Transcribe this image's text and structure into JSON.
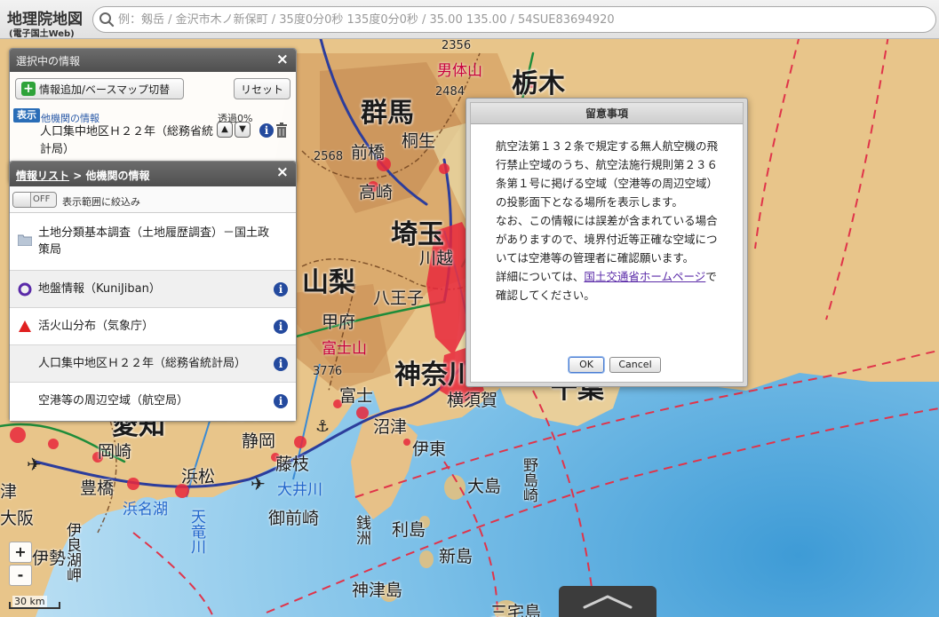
{
  "header": {
    "logo_title": "地理院地図",
    "logo_subtitle": "(電子国土Web)",
    "search_placeholder": "例：剱岳 / 金沢市木ノ新保町 / 35度0分0秒 135度0分0秒 / 35.00 135.00 / 54SUE83694920"
  },
  "selected_panel": {
    "title": "選択中の情報",
    "add_button_label": "情報追加/ベースマップ切替",
    "reset_button_label": "リセット",
    "show_badge": "表示",
    "item_category": "他機関の情報",
    "item_name": "人口集中地区Ｈ２２年（総務省統計局）",
    "opacity_label": "透過0%"
  },
  "list_panel": {
    "breadcrumb_link": "情報リスト",
    "breadcrumb_sep": " > ",
    "breadcrumb_current": "他機関の情報",
    "toggle_label": "OFF",
    "filter_label": "表示範囲に絞込み",
    "items": [
      {
        "label": "土地分類基本調査（土地履歴調査）－国土政策局",
        "icon": "folder-icon"
      },
      {
        "label": "地盤情報（KuniJiban）",
        "icon": "circle-icon"
      },
      {
        "label": "活火山分布（気象庁）",
        "icon": "triangle-icon"
      },
      {
        "label": "人口集中地区Ｈ２２年（総務省統計局）",
        "icon": ""
      },
      {
        "label": "空港等の周辺空域（航空局）",
        "icon": ""
      }
    ]
  },
  "dialog": {
    "title": "留意事項",
    "paragraph1": "航空法第１３２条で規定する無人航空機の飛行禁止空域のうち、航空法施行規則第２３６条第１号に掲げる空域（空港等の周辺空域）の投影面下となる場所を表示します。",
    "paragraph2": "なお、この情報には誤差が含まれている場合がありますので、境界付近等正確な空域については空港等の管理者に確認願います。",
    "paragraph3_prefix": "詳細については、",
    "paragraph3_link": "国土交通省ホームページ",
    "paragraph3_suffix": "で確認してください。",
    "ok_label": "OK",
    "cancel_label": "Cancel"
  },
  "map": {
    "zoom_in_label": "+",
    "zoom_out_label": "-",
    "scale_label": "30 km",
    "labels": {
      "tochigi": "栃木",
      "gunma": "群馬",
      "saitama": "埼玉",
      "yamanashi": "山梨",
      "kanagawa": "神奈川",
      "shizuoka": "静岡",
      "aichi": "愛知",
      "chiba": "千葉",
      "maebashi": "前橋",
      "takasaki": "高崎",
      "kiryu": "桐生",
      "hachioji": "八王子",
      "kofu": "甲府",
      "kawagoe": "川越",
      "yokosuka": "横須賀",
      "fuji": "富士",
      "numazu": "沼津",
      "ito": "伊東",
      "shizuoka_city": "静岡",
      "fujieda": "藤枝",
      "hamamatsu": "浜松",
      "toyohashi": "豊橋",
      "okazaki": "岡崎",
      "omaezaki": "御前崎",
      "oshima": "大島",
      "toshima": "利島",
      "niijima": "新島",
      "kozushima": "神津島",
      "miyakejima": "三宅島",
      "nantaisan": "男体山",
      "fujisan": "富士山",
      "hamanako": "浜名湖",
      "oigawa": "大井川",
      "tenryugawa": "天竜川",
      "nojimazaki": "野島崎",
      "zenisu": "銭洲",
      "irago": "伊良湖岬",
      "osaka": "大阪",
      "ise": "伊勢",
      "tsu": "津",
      "elev_2356": "2356",
      "elev_2484": "2484",
      "elev_2568": "2568",
      "elev_3776": "3776"
    }
  },
  "colors": {
    "accent": "#2a6db7",
    "info_icon": "#244a9e",
    "link": "#5a2aa8",
    "airspace_line": "#e0344a",
    "populated_area": "#e8283c"
  }
}
